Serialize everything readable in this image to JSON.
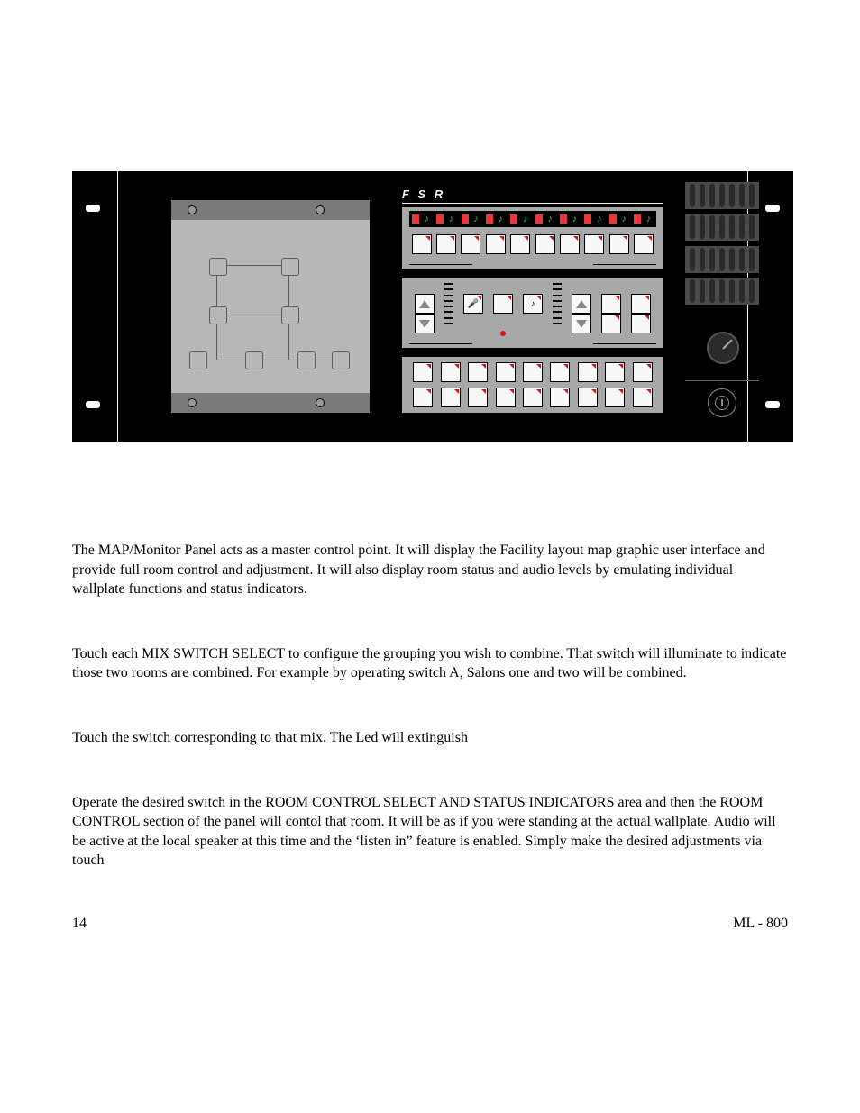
{
  "figure": {
    "brand_label": "F S R"
  },
  "paragraphs": {
    "p1": "The MAP/Monitor Panel acts as a master control point. It will display the Facility layout map graphic user interface and provide full room control and adjustment.  It will also display room status and audio levels by emulating individual wallplate functions and status indicators.",
    "p2": "Touch each MIX SWITCH SELECT to configure the grouping you wish to combine.  That switch will illuminate to indicate those two rooms are combined. For example by operating switch A, Salons one and two will be combined.",
    "p3": "Touch the switch corresponding to that mix. The Led will extinguish",
    "p4": "Operate the desired switch in the ROOM CONTROL SELECT AND STATUS INDICATORS area and then the ROOM CONTROL section of the panel will contol that room. It will be as if you were standing at the actual wallplate. Audio will be active at the local speaker at this time and the ‘listen in” feature is enabled.  Simply make the desired adjustments via touch"
  },
  "footer": {
    "page": "14",
    "doc": "ML - 800"
  }
}
